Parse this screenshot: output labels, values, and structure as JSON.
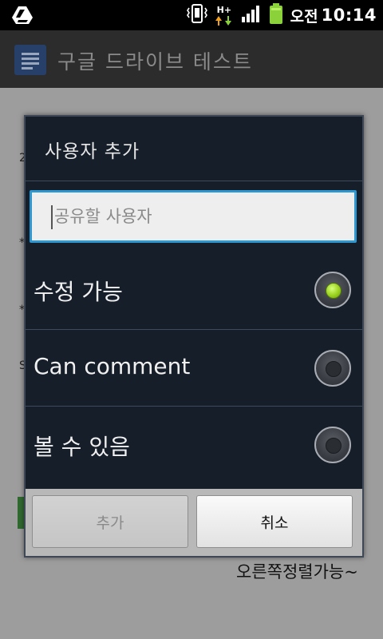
{
  "status_bar": {
    "network": "H+",
    "ampm": "오전",
    "time": "10:14"
  },
  "action_bar": {
    "title": "구글 드라이브 테스트"
  },
  "background": {
    "bottom_text": "오른쪽정렬가능~"
  },
  "dialog": {
    "title": "사용자 추가",
    "input_placeholder": "공유할 사용자",
    "input_value": "",
    "options": [
      {
        "label": "수정 가능",
        "selected": true
      },
      {
        "label": "Can comment",
        "selected": false
      },
      {
        "label": "볼 수 있음",
        "selected": false
      }
    ],
    "buttons": {
      "add": "추가",
      "cancel": "취소"
    }
  },
  "colors": {
    "dialog_bg": "#161e2a",
    "input_focus": "#2c97d0",
    "radio_selected": "#9ad11e"
  }
}
